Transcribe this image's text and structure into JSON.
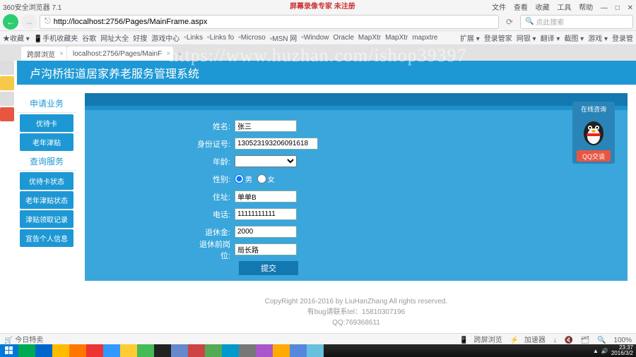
{
  "browser": {
    "title": "360安全浏览器 7.1",
    "menus": [
      "文件",
      "查看",
      "收藏",
      "工具",
      "帮助"
    ],
    "url": "http://localhost:2756/Pages/MainFrame.aspx",
    "search_placeholder": "点此搜索",
    "bookmarks": [
      "收藏",
      "手机收藏夹",
      "谷歌",
      "网址大全",
      "好搜",
      "游戏中心",
      "Links",
      "Links fo",
      "Microso",
      "MSN 网",
      "Window",
      "Oracle",
      "MapXtr",
      "MapXtr",
      "mapxtre"
    ],
    "bm_right": [
      "扩展",
      "登录管家",
      "网银",
      "翻译",
      "截图",
      "游戏",
      "登录管"
    ],
    "tabs": [
      "跨屏浏览",
      "localhost:2756/Pages/MainF"
    ]
  },
  "rec_badge": "屏幕录像专家 未注册",
  "watermark": "https://www.huzhan.com/ishop39397",
  "app": {
    "title": "卢沟桥街道居家养老服务管理系统",
    "menu1": {
      "header": "申请业务",
      "items": [
        "优待卡",
        "老年津贴"
      ]
    },
    "menu2": {
      "header": "查询服务",
      "items": [
        "优待卡状态",
        "老年津贴状态",
        "津贴领取记录",
        "宣告个人信息"
      ]
    },
    "form": {
      "name_lbl": "姓名:",
      "name_val": "张三",
      "id_lbl": "身份证号:",
      "id_val": "130523193206091618",
      "age_lbl": "年龄:",
      "sex_lbl": "性别:",
      "sex_m": "男",
      "sex_f": "女",
      "addr_lbl": "住址:",
      "addr_val": "单单B",
      "tel_lbl": "电话:",
      "tel_val": "11111111111",
      "pension_lbl": "退休金:",
      "pension_val": "2000",
      "post_lbl": "退休前岗位:",
      "post_val": "局长路",
      "submit": "提交"
    },
    "widget": {
      "title": "在线咨询",
      "btn": "QQ交谈"
    },
    "footer": {
      "l1": "CopyRight 2016-2016 by LiuHanZhang All rights reserved.",
      "l2": "有bug请联系tel：15810307196",
      "l3": "QQ:769368611"
    }
  },
  "status": {
    "left": "今日特卖",
    "r1": "跨屏浏览",
    "r2": "加速器",
    "zoom": "100%"
  },
  "tray": {
    "time": "23:37",
    "date": "2016/3/2"
  }
}
